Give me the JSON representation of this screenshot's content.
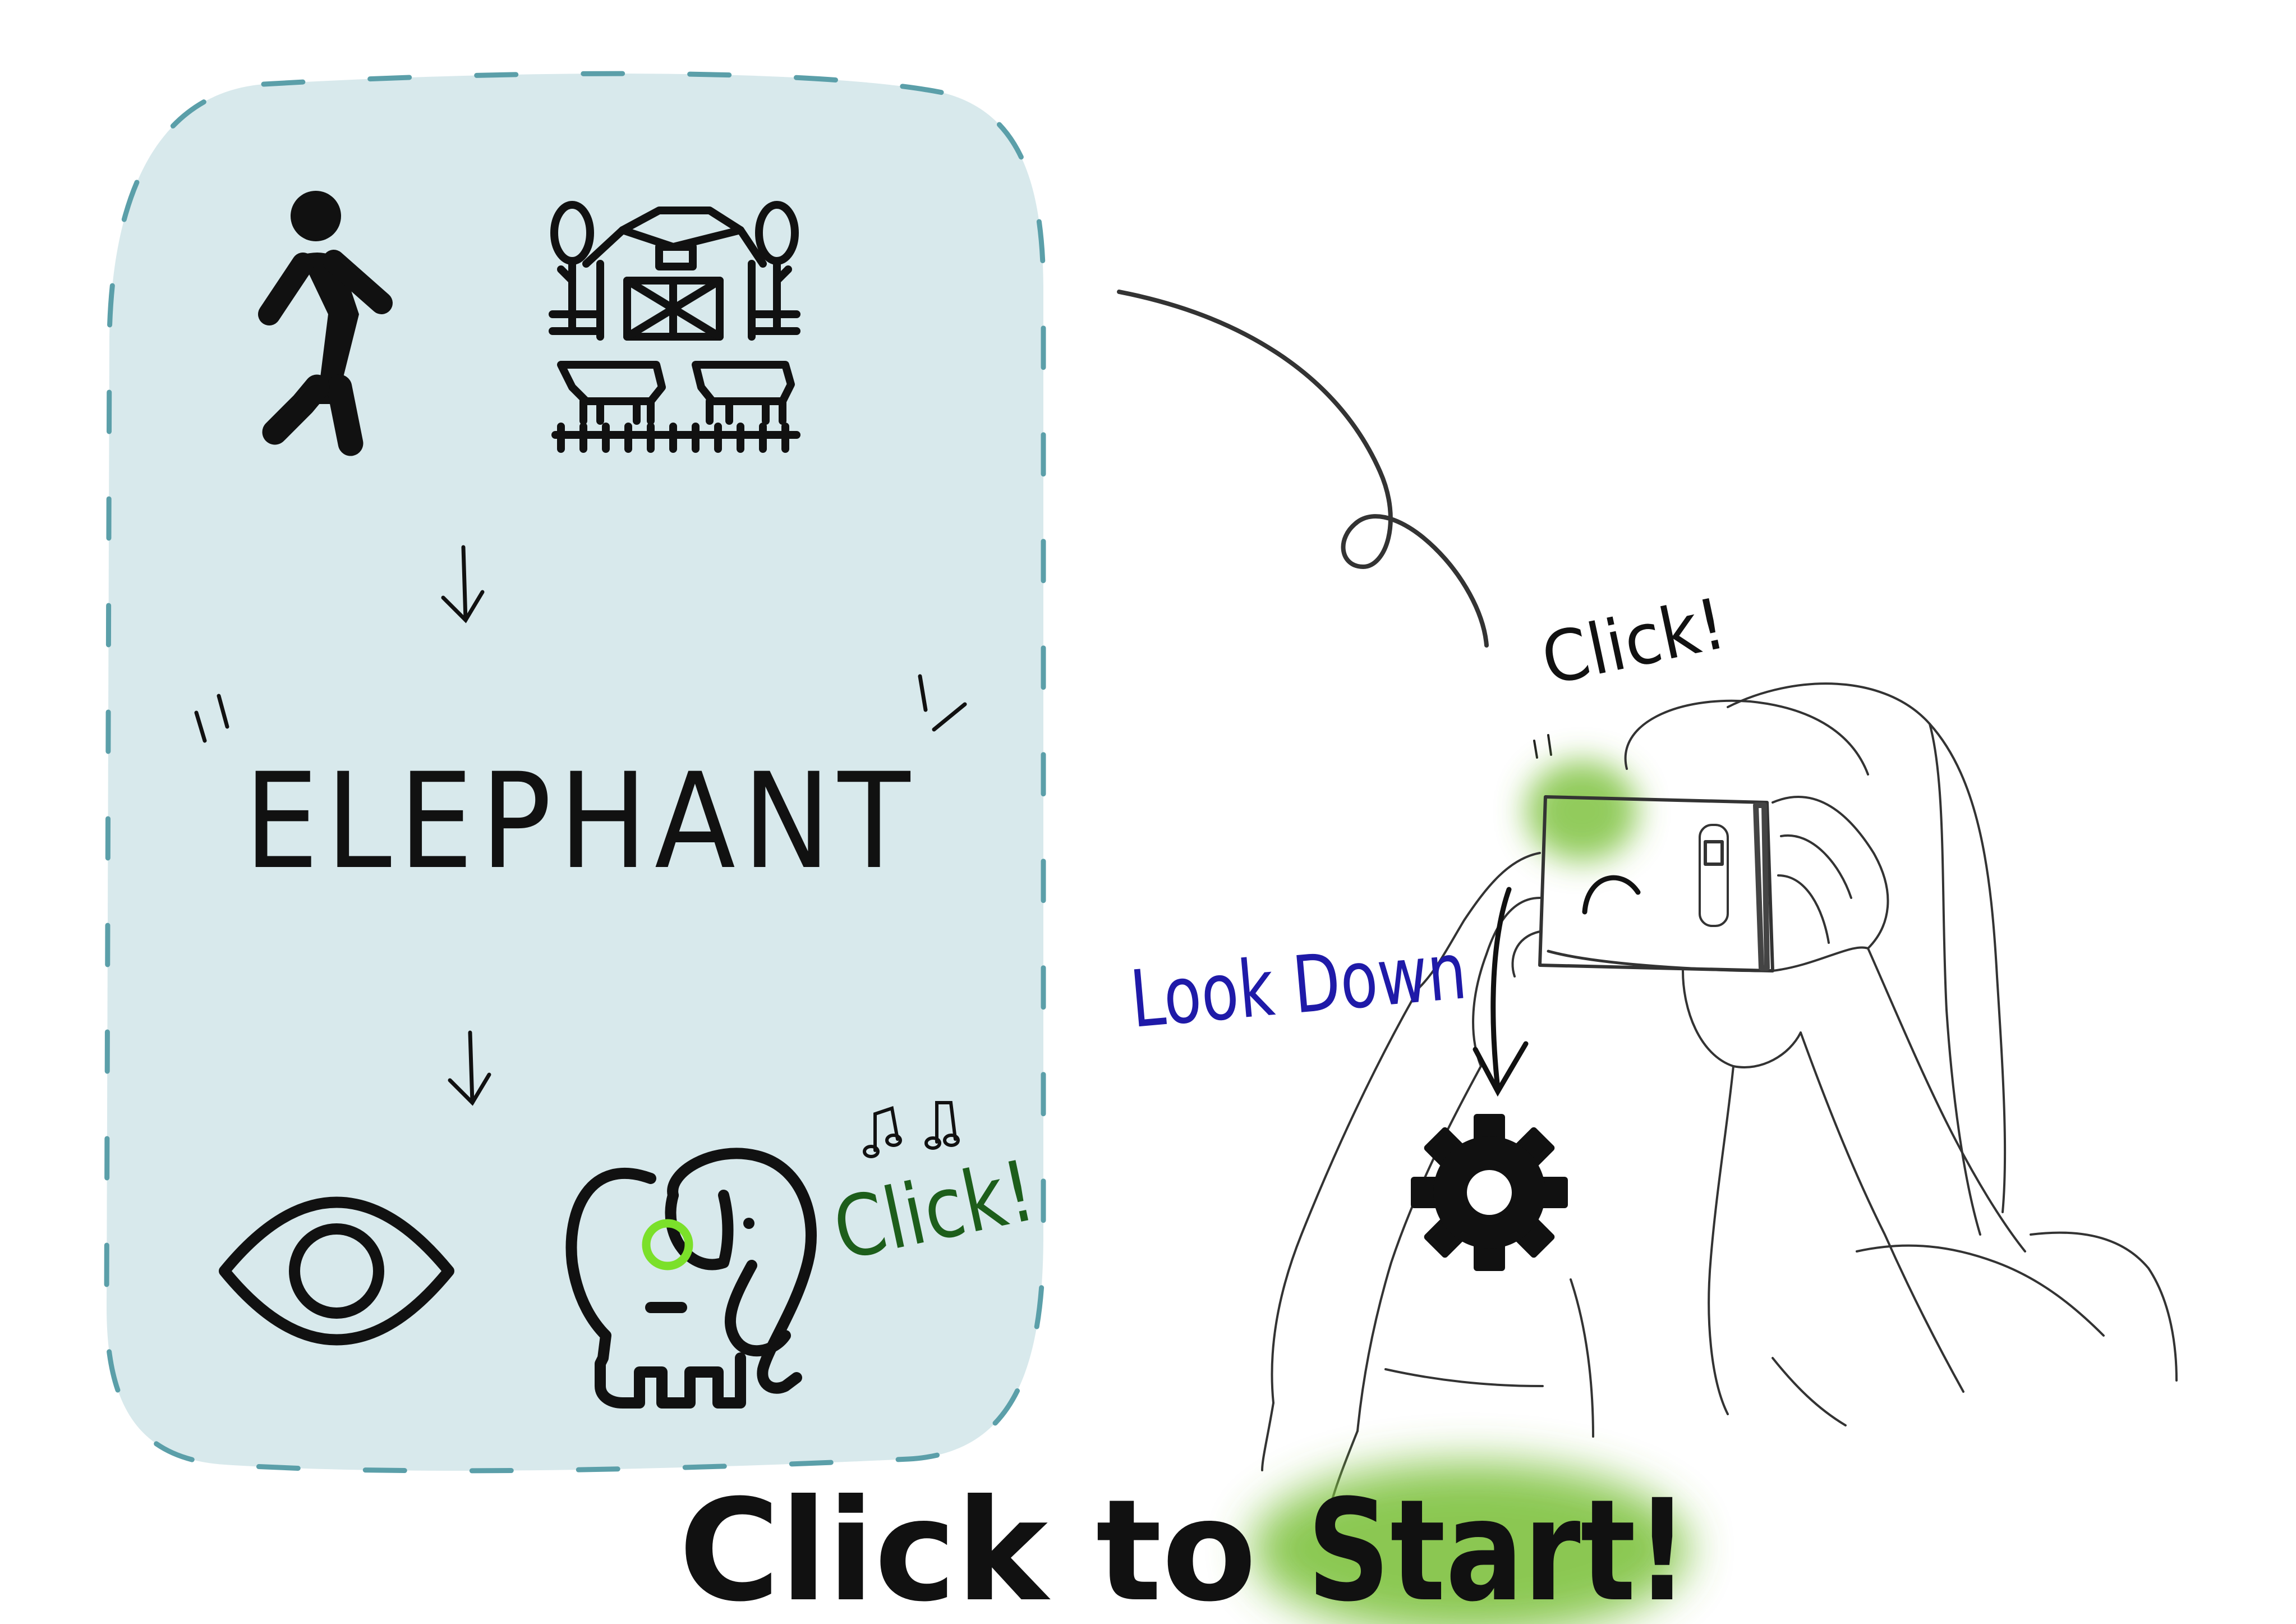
{
  "panel": {
    "word": "ELEPHANT",
    "elephant_click": "Click!"
  },
  "illustration": {
    "top_click": "Click!",
    "look_down": "Look Down"
  },
  "cta": {
    "prefix": "Click to",
    "highlight": "Start!"
  },
  "colors": {
    "panel_fill": "#d8e9ec",
    "panel_dash": "#5b9fa9",
    "green_glow": "#7fc241",
    "green_ring": "#7be02a",
    "look_down_text": "#1f1aa8",
    "click_green_text": "#1d5e1b",
    "ink": "#111111"
  },
  "icons": [
    "walking-person-icon",
    "farm-icon",
    "arrow-down-icon",
    "eye-icon",
    "elephant-icon",
    "music-notes-icon",
    "gear-icon"
  ]
}
